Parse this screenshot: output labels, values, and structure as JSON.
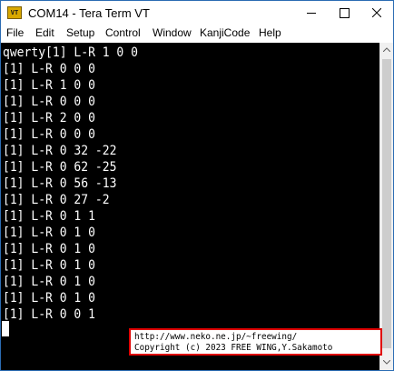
{
  "window": {
    "title": "COM14 - Tera Term VT",
    "icon": "teraterm-app-icon",
    "icon_text": "VT"
  },
  "menu": [
    "File",
    "Edit",
    "Setup",
    "Control",
    "Window",
    "KanjiCode",
    "Help"
  ],
  "terminal": {
    "lines": [
      "qwerty[1] L-R 1 0 0",
      "[1] L-R 0 0 0",
      "[1] L-R 1 0 0",
      "[1] L-R 0 0 0",
      "[1] L-R 2 0 0",
      "[1] L-R 0 0 0",
      "[1] L-R 0 32 -22",
      "[1] L-R 0 62 -25",
      "[1] L-R 0 56 -13",
      "[1] L-R 0 27 -2",
      "[1] L-R 0 1 1",
      "[1] L-R 0 1 0",
      "[1] L-R 0 1 0",
      "[1] L-R 0 1 0",
      "[1] L-R 0 1 0",
      "[1] L-R 0 1 0",
      "[1] L-R 0 0 1"
    ]
  },
  "splash": {
    "url": "http://www.neko.ne.jp/~freewing/",
    "copyright": "Copyright (c) 2023 FREE WING,Y.Sakamoto"
  },
  "colors": {
    "terminal_bg": "#000000",
    "terminal_fg": "#ffffff",
    "window_border": "#2b6cb3",
    "splash_border": "#e00000"
  }
}
